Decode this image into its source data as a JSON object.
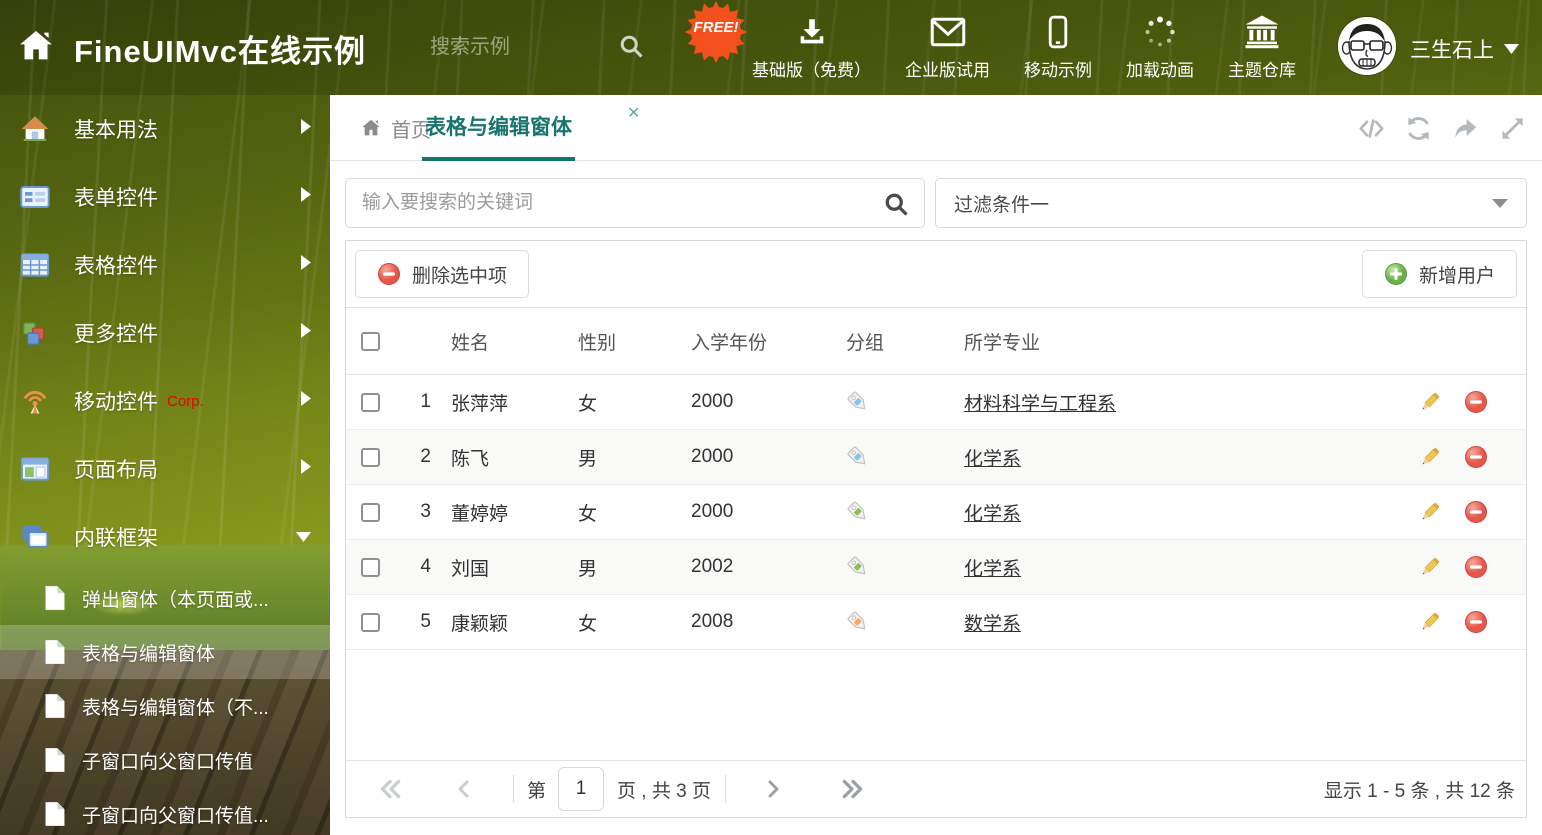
{
  "header": {
    "title": "FineUIMvc在线示例",
    "search_placeholder": "搜索示例",
    "free_badge": "FREE!",
    "nav_items": [
      {
        "id": "basic",
        "label": "基础版（免费）",
        "icon": "download-icon"
      },
      {
        "id": "enterprise",
        "label": "企业版试用",
        "icon": "envelope-icon"
      },
      {
        "id": "mobile",
        "label": "移动示例",
        "icon": "mobile-icon"
      },
      {
        "id": "loading",
        "label": "加载动画",
        "icon": "spinner-icon"
      },
      {
        "id": "theme",
        "label": "主题仓库",
        "icon": "bank-icon"
      }
    ],
    "username": "三生石上"
  },
  "sidebar": {
    "items": [
      {
        "id": "basic-usage",
        "label": "基本用法",
        "icon": "home"
      },
      {
        "id": "form-controls",
        "label": "表单控件",
        "icon": "form"
      },
      {
        "id": "grid-controls",
        "label": "表格控件",
        "icon": "table"
      },
      {
        "id": "more-controls",
        "label": "更多控件",
        "icon": "cubes"
      },
      {
        "id": "mobile-controls",
        "label": "移动控件",
        "badge": "Corp.",
        "icon": "antenna"
      },
      {
        "id": "page-layout",
        "label": "页面布局",
        "icon": "layout"
      },
      {
        "id": "inline-frame",
        "label": "内联框架",
        "icon": "frames",
        "expanded": true
      }
    ],
    "subitems": [
      {
        "id": "popup-window",
        "label": "弹出窗体（本页面或..."
      },
      {
        "id": "grid-edit-window",
        "label": "表格与编辑窗体",
        "selected": true
      },
      {
        "id": "grid-edit-window-2",
        "label": "表格与编辑窗体（不..."
      },
      {
        "id": "child-to-parent",
        "label": "子窗口向父窗口传值"
      },
      {
        "id": "child-to-parent-2",
        "label": "子窗口向父窗口传值..."
      }
    ]
  },
  "tabs": [
    {
      "label": "首页",
      "active": false
    },
    {
      "label": "表格与编辑窗体",
      "active": true
    }
  ],
  "filters": {
    "search_placeholder": "输入要搜索的关键词",
    "filter_value": "过滤条件一"
  },
  "toolbar": {
    "delete_label": "删除选中项",
    "add_label": "新增用户"
  },
  "table": {
    "columns": [
      "姓名",
      "性别",
      "入学年份",
      "分组",
      "所学专业"
    ],
    "rows": [
      {
        "num": "1",
        "name": "张萍萍",
        "gender": "女",
        "year": "2000",
        "tag_color": "blue",
        "major": "材料科学与工程系"
      },
      {
        "num": "2",
        "name": "陈飞",
        "gender": "男",
        "year": "2000",
        "tag_color": "blue",
        "major": "化学系"
      },
      {
        "num": "3",
        "name": "董婷婷",
        "gender": "女",
        "year": "2000",
        "tag_color": "green",
        "major": "化学系"
      },
      {
        "num": "4",
        "name": "刘国",
        "gender": "男",
        "year": "2002",
        "tag_color": "green",
        "major": "化学系"
      },
      {
        "num": "5",
        "name": "康颖颖",
        "gender": "女",
        "year": "2008",
        "tag_color": "orange",
        "major": "数学系"
      }
    ]
  },
  "pagination": {
    "page_prefix": "第",
    "current_page": "1",
    "page_suffix": "页 , 共 3 页",
    "summary": "显示 1 - 5 条 , 共 12 条"
  },
  "colors": {
    "accent": "#17756e",
    "free_badge": "#f4501e",
    "corp_red": "#ee0000",
    "tag_blue": "#85c5ee",
    "tag_green": "#8bc153",
    "tag_orange": "#f8a95e"
  }
}
